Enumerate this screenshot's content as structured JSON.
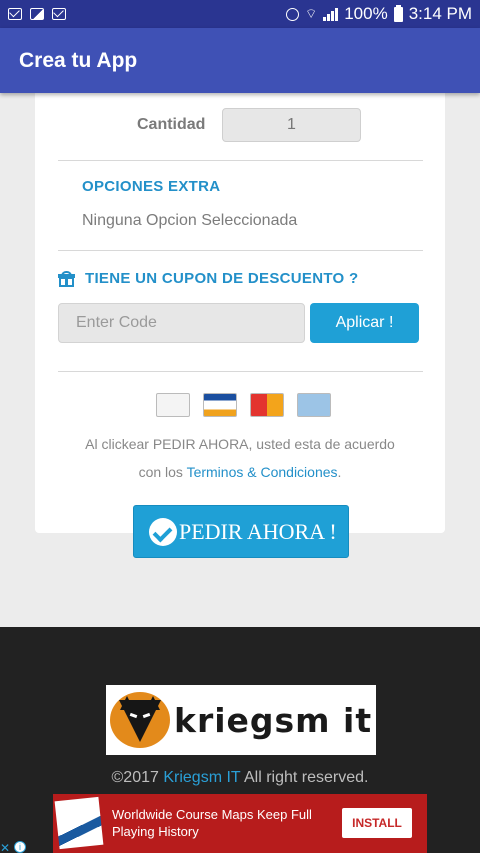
{
  "status_bar": {
    "battery": "100%",
    "time": "3:14 PM"
  },
  "app_bar": {
    "title": "Crea tu App"
  },
  "order": {
    "quantity_label": "Cantidad",
    "quantity_value": "1",
    "extras_title": "OPCIONES EXTRA",
    "extras_value": "Ninguna Opcion Seleccionada",
    "coupon_title": "TIENE UN CUPON DE DESCUENTO ?",
    "coupon_placeholder": "Enter Code",
    "apply_label": "Aplicar !",
    "payment_methods": [
      "paypal",
      "visa",
      "mastercard",
      "amex"
    ],
    "terms_line1": "Al clickear PEDIR AHORA, usted esta de acuerdo",
    "terms_prefix": "con los ",
    "terms_link": "Terminos & Condiciones",
    "terms_suffix": ".",
    "order_button": "PEDIR AHORA !"
  },
  "footer": {
    "logo_text": "kriegsm it",
    "copyright_prefix": "©2017 ",
    "copyright_link": "Kriegsm IT",
    "copyright_suffix": " All right reserved."
  },
  "ad": {
    "text": "Worldwide Course Maps Keep Full Playing History",
    "install_label": "INSTALL"
  },
  "colors": {
    "status_bar": "#2a3591",
    "app_bar": "#3f51b5",
    "accent": "#1fa0d6",
    "footer": "#222222",
    "ad_background": "#b71c1c"
  }
}
